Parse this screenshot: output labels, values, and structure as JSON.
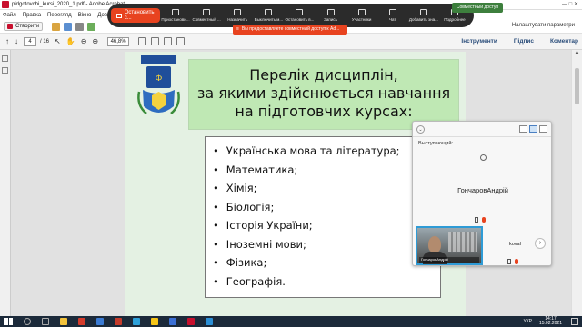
{
  "window": {
    "title": "pidgotovchi_kursi_2020_1.pdf - Adobe Acrobat",
    "controls": "— □ ✕"
  },
  "menu": [
    "Файл",
    "Правка",
    "Перегляд",
    "Вікно",
    "Довідка"
  ],
  "toolbar": {
    "create_label": "Створити",
    "share_label": "Налаштувати параметри"
  },
  "navigation": {
    "current_page": "4",
    "total_pages": "/ 16",
    "zoom": "46,8%"
  },
  "right_tabs": [
    "Інструменти",
    "Підпис",
    "Коментар"
  ],
  "document": {
    "logo_text": "ФІЗИКО-МАТЕМАТИЧНИЙ ЛІЦЕЙ",
    "heading": [
      "Перелік дисциплін,",
      "за якими здійснюється навчання",
      "на підготовчих курсах:"
    ],
    "subjects": [
      "Українська мова та література;",
      "Математика;",
      "Хімія;",
      "Біологія;",
      "Історія України;",
      "Іноземні мови;",
      "Фізика;",
      "Географія."
    ]
  },
  "meeting": {
    "stop_label": "Остановить с...",
    "buttons": [
      "Приостанови...",
      "Совместный ...",
      "Назначить",
      "Выключить м...",
      "Остановить в...",
      "Запись",
      "Участники",
      "Чат",
      "Добавить зна...",
      "Подробнее"
    ],
    "notice": "Совместный доступ",
    "tooltip": "Вы предоставляете совместный доступ к Ad...",
    "speaker_label": "Выступающий:",
    "speaker_name": "ГончаровАндрій",
    "thumb_label": "ГончаровАндрій",
    "other_participant": "koval"
  },
  "taskbar": {
    "language": "УКР",
    "time": "14:17",
    "date": "15.02.2021"
  },
  "colors": {
    "heading_bg": "#bfe8b4",
    "page_bg": "#e4f1e3",
    "stop_button": "#e8431f",
    "active_video_border": "#2e9bd6"
  }
}
